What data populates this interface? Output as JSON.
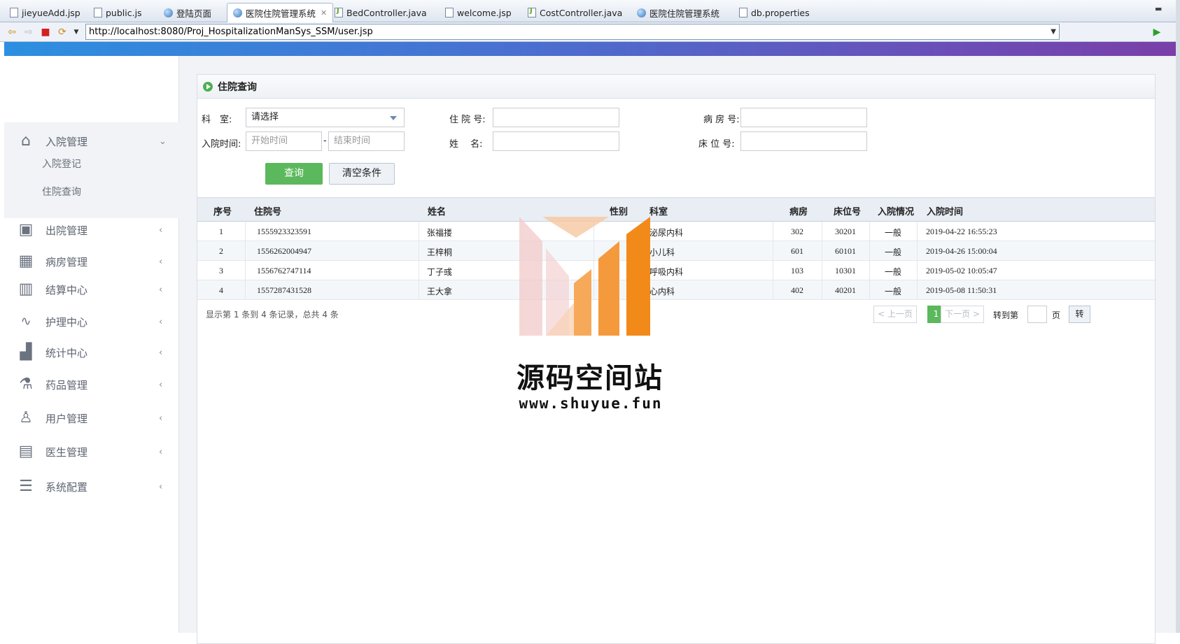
{
  "editor_tabs": [
    {
      "label": "jieyueAdd.jsp",
      "icon": "jsp-file-icon"
    },
    {
      "label": "public.js",
      "icon": "js-file-icon"
    },
    {
      "label": "登陆页面",
      "icon": "globe-icon"
    },
    {
      "label": "医院住院管理系统",
      "icon": "globe-icon",
      "active": true
    },
    {
      "label": "BedController.java",
      "icon": "java-file-icon"
    },
    {
      "label": "welcome.jsp",
      "icon": "jsp-file-icon"
    },
    {
      "label": "CostController.java",
      "icon": "java-file-icon"
    },
    {
      "label": "医院住院管理系统",
      "icon": "globe-icon"
    },
    {
      "label": "db.properties",
      "icon": "properties-file-icon"
    }
  ],
  "browser": {
    "url": "http://localhost:8080/Proj_HospitalizationManSys_SSM/user.jsp"
  },
  "sidebar": {
    "items": [
      {
        "label": "入院管理",
        "icon": "home-icon",
        "expanded": true
      },
      {
        "label": "出院管理",
        "icon": "window-icon"
      },
      {
        "label": "病房管理",
        "icon": "building-icon"
      },
      {
        "label": "结算中心",
        "icon": "map-icon"
      },
      {
        "label": "护理中心",
        "icon": "pulse-icon"
      },
      {
        "label": "统计中心",
        "icon": "bar-chart-icon"
      },
      {
        "label": "药品管理",
        "icon": "flask-icon"
      },
      {
        "label": "用户管理",
        "icon": "user-icon"
      },
      {
        "label": "医生管理",
        "icon": "id-card-icon"
      },
      {
        "label": "系统配置",
        "icon": "list-icon"
      }
    ],
    "subitems": [
      "入院登记",
      "住院查询"
    ]
  },
  "panel": {
    "title": "住院查询"
  },
  "form": {
    "dept_label": "科　室:",
    "dept_value": "请选择",
    "admit_no_label": "住 院 号:",
    "room_no_label": "病 房 号:",
    "admit_time_label": "入院时间:",
    "start_placeholder": "开始时间",
    "end_placeholder": "结束时间",
    "dash": "-",
    "name_label": "姓　 名:",
    "bed_no_label": "床 位 号:",
    "query_button": "查询",
    "clear_button": "清空条件"
  },
  "table": {
    "headers": [
      "序号",
      "住院号",
      "姓名",
      "性别",
      "科室",
      "病房",
      "床位号",
      "入院情况",
      "入院时间"
    ],
    "rows": [
      [
        "1",
        "1555923323591",
        "张福搂",
        "",
        "泌尿内科",
        "302",
        "30201",
        "一般",
        "2019-04-22 16:55:23"
      ],
      [
        "2",
        "1556262004947",
        "王梓桐",
        "",
        "小儿科",
        "601",
        "60101",
        "一般",
        "2019-04-26 15:00:04"
      ],
      [
        "3",
        "1556762747114",
        "丁子彧",
        "",
        "呼吸内科",
        "103",
        "10301",
        "一般",
        "2019-05-02 10:05:47"
      ],
      [
        "4",
        "1557287431528",
        "王大拿",
        "",
        "心内科",
        "402",
        "40201",
        "一般",
        "2019-05-08 11:50:31"
      ]
    ]
  },
  "pagination": {
    "summary": "显示第 1 条到 4 条记录，总共 4 条",
    "prev": "< 上一页",
    "current": "1",
    "next": "下一页 >",
    "goto_label": "转到第",
    "page_unit": "页",
    "go_button": "转"
  },
  "watermark": {
    "title": "源码空间站",
    "url": "www.shuyue.fun"
  },
  "colors": {
    "accent_green": "#5cb85c",
    "header_gradient_start": "#2c8fe0",
    "header_gradient_end": "#7a3fa8"
  }
}
